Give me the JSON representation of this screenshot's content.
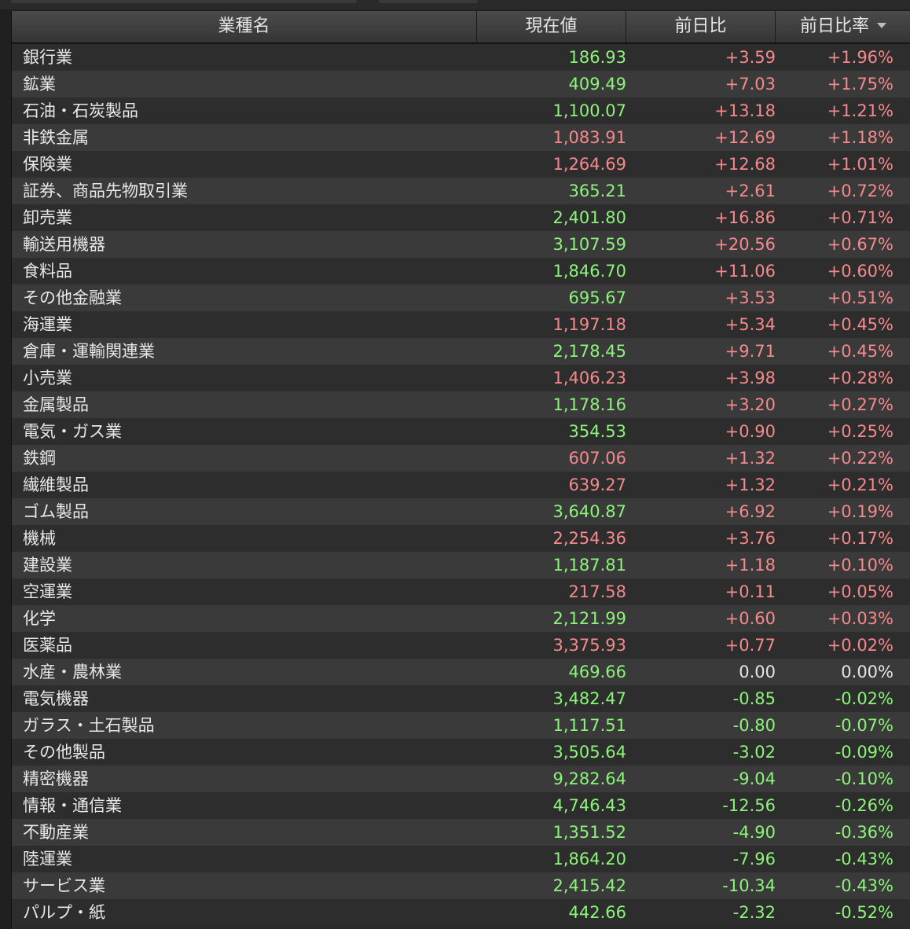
{
  "colors": {
    "up_green": "#8cf47a",
    "up_red": "#f5898b",
    "neutral": "#e6e6e6",
    "background": "#2b2b2b"
  },
  "header": {
    "name": "業種名",
    "price": "現在値",
    "change": "前日比",
    "change_rate": "前日比率",
    "sort_icon": "chevron-down-icon"
  },
  "rows": [
    {
      "name": "銀行業",
      "price": "186.93",
      "price_color": "green",
      "change": "+3.59",
      "change_color": "red",
      "rate": "+1.96%",
      "rate_color": "red"
    },
    {
      "name": "鉱業",
      "price": "409.49",
      "price_color": "green",
      "change": "+7.03",
      "change_color": "red",
      "rate": "+1.75%",
      "rate_color": "red"
    },
    {
      "name": "石油・石炭製品",
      "price": "1,100.07",
      "price_color": "green",
      "change": "+13.18",
      "change_color": "red",
      "rate": "+1.21%",
      "rate_color": "red"
    },
    {
      "name": "非鉄金属",
      "price": "1,083.91",
      "price_color": "red",
      "change": "+12.69",
      "change_color": "red",
      "rate": "+1.18%",
      "rate_color": "red"
    },
    {
      "name": "保険業",
      "price": "1,264.69",
      "price_color": "red",
      "change": "+12.68",
      "change_color": "red",
      "rate": "+1.01%",
      "rate_color": "red"
    },
    {
      "name": "証券、商品先物取引業",
      "price": "365.21",
      "price_color": "green",
      "change": "+2.61",
      "change_color": "red",
      "rate": "+0.72%",
      "rate_color": "red"
    },
    {
      "name": "卸売業",
      "price": "2,401.80",
      "price_color": "green",
      "change": "+16.86",
      "change_color": "red",
      "rate": "+0.71%",
      "rate_color": "red"
    },
    {
      "name": "輸送用機器",
      "price": "3,107.59",
      "price_color": "green",
      "change": "+20.56",
      "change_color": "red",
      "rate": "+0.67%",
      "rate_color": "red"
    },
    {
      "name": "食料品",
      "price": "1,846.70",
      "price_color": "green",
      "change": "+11.06",
      "change_color": "red",
      "rate": "+0.60%",
      "rate_color": "red"
    },
    {
      "name": "その他金融業",
      "price": "695.67",
      "price_color": "green",
      "change": "+3.53",
      "change_color": "red",
      "rate": "+0.51%",
      "rate_color": "red"
    },
    {
      "name": "海運業",
      "price": "1,197.18",
      "price_color": "red",
      "change": "+5.34",
      "change_color": "red",
      "rate": "+0.45%",
      "rate_color": "red"
    },
    {
      "name": "倉庫・運輸関連業",
      "price": "2,178.45",
      "price_color": "green",
      "change": "+9.71",
      "change_color": "red",
      "rate": "+0.45%",
      "rate_color": "red"
    },
    {
      "name": "小売業",
      "price": "1,406.23",
      "price_color": "red",
      "change": "+3.98",
      "change_color": "red",
      "rate": "+0.28%",
      "rate_color": "red"
    },
    {
      "name": "金属製品",
      "price": "1,178.16",
      "price_color": "green",
      "change": "+3.20",
      "change_color": "red",
      "rate": "+0.27%",
      "rate_color": "red"
    },
    {
      "name": "電気・ガス業",
      "price": "354.53",
      "price_color": "green",
      "change": "+0.90",
      "change_color": "red",
      "rate": "+0.25%",
      "rate_color": "red"
    },
    {
      "name": "鉄鋼",
      "price": "607.06",
      "price_color": "red",
      "change": "+1.32",
      "change_color": "red",
      "rate": "+0.22%",
      "rate_color": "red"
    },
    {
      "name": "繊維製品",
      "price": "639.27",
      "price_color": "red",
      "change": "+1.32",
      "change_color": "red",
      "rate": "+0.21%",
      "rate_color": "red"
    },
    {
      "name": "ゴム製品",
      "price": "3,640.87",
      "price_color": "green",
      "change": "+6.92",
      "change_color": "red",
      "rate": "+0.19%",
      "rate_color": "red"
    },
    {
      "name": "機械",
      "price": "2,254.36",
      "price_color": "red",
      "change": "+3.76",
      "change_color": "red",
      "rate": "+0.17%",
      "rate_color": "red"
    },
    {
      "name": "建設業",
      "price": "1,187.81",
      "price_color": "green",
      "change": "+1.18",
      "change_color": "red",
      "rate": "+0.10%",
      "rate_color": "red"
    },
    {
      "name": "空運業",
      "price": "217.58",
      "price_color": "red",
      "change": "+0.11",
      "change_color": "red",
      "rate": "+0.05%",
      "rate_color": "red"
    },
    {
      "name": "化学",
      "price": "2,121.99",
      "price_color": "green",
      "change": "+0.60",
      "change_color": "red",
      "rate": "+0.03%",
      "rate_color": "red"
    },
    {
      "name": "医薬品",
      "price": "3,375.93",
      "price_color": "red",
      "change": "+0.77",
      "change_color": "red",
      "rate": "+0.02%",
      "rate_color": "red"
    },
    {
      "name": "水産・農林業",
      "price": "469.66",
      "price_color": "green",
      "change": "0.00",
      "change_color": "white",
      "rate": "0.00%",
      "rate_color": "white"
    },
    {
      "name": "電気機器",
      "price": "3,482.47",
      "price_color": "green",
      "change": "-0.85",
      "change_color": "green",
      "rate": "-0.02%",
      "rate_color": "green"
    },
    {
      "name": "ガラス・土石製品",
      "price": "1,117.51",
      "price_color": "green",
      "change": "-0.80",
      "change_color": "green",
      "rate": "-0.07%",
      "rate_color": "green"
    },
    {
      "name": "その他製品",
      "price": "3,505.64",
      "price_color": "green",
      "change": "-3.02",
      "change_color": "green",
      "rate": "-0.09%",
      "rate_color": "green"
    },
    {
      "name": "精密機器",
      "price": "9,282.64",
      "price_color": "green",
      "change": "-9.04",
      "change_color": "green",
      "rate": "-0.10%",
      "rate_color": "green"
    },
    {
      "name": "情報・通信業",
      "price": "4,746.43",
      "price_color": "green",
      "change": "-12.56",
      "change_color": "green",
      "rate": "-0.26%",
      "rate_color": "green"
    },
    {
      "name": "不動産業",
      "price": "1,351.52",
      "price_color": "green",
      "change": "-4.90",
      "change_color": "green",
      "rate": "-0.36%",
      "rate_color": "green"
    },
    {
      "name": "陸運業",
      "price": "1,864.20",
      "price_color": "green",
      "change": "-7.96",
      "change_color": "green",
      "rate": "-0.43%",
      "rate_color": "green"
    },
    {
      "name": "サービス業",
      "price": "2,415.42",
      "price_color": "green",
      "change": "-10.34",
      "change_color": "green",
      "rate": "-0.43%",
      "rate_color": "green"
    },
    {
      "name": "パルプ・紙",
      "price": "442.66",
      "price_color": "green",
      "change": "-2.32",
      "change_color": "green",
      "rate": "-0.52%",
      "rate_color": "green"
    }
  ]
}
